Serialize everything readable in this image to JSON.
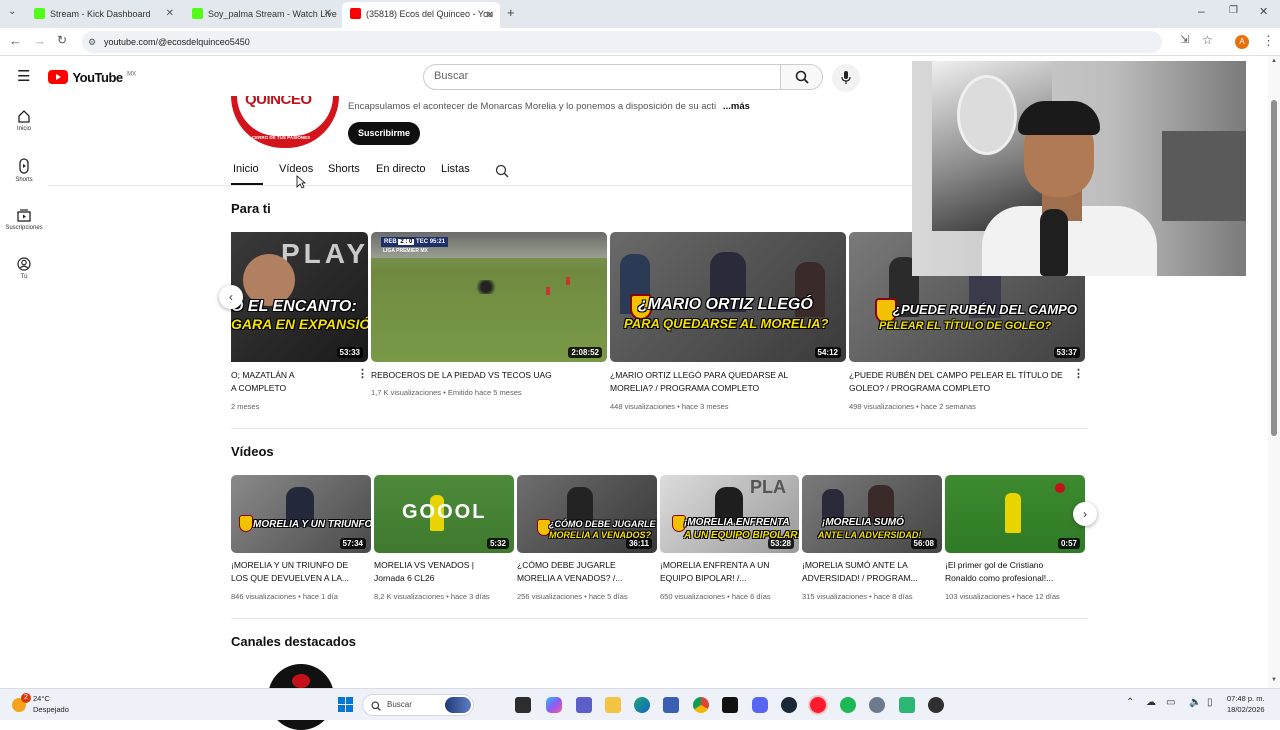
{
  "browser": {
    "tabs": [
      {
        "label": "Stream - Kick Dashboard",
        "active": false
      },
      {
        "label": "Soy_palma Stream - Watch Live",
        "active": false
      },
      {
        "label": "(35818) Ecos del Quinceo - You",
        "active": true
      }
    ],
    "new_tab_label": "+",
    "url": "youtube.com/@ecosdelquinceo5450"
  },
  "yt": {
    "logo_text": "YouTube",
    "region": "MX",
    "search_placeholder": "Buscar"
  },
  "sidebar": {
    "items": [
      {
        "label": "Inicio",
        "icon": "home-icon"
      },
      {
        "label": "Shorts",
        "icon": "shorts-icon"
      },
      {
        "label": "Suscripciones",
        "icon": "subscriptions-icon"
      },
      {
        "label": "Tú",
        "icon": "you-icon"
      }
    ]
  },
  "channel": {
    "avatar_text_1": "QUINCEO",
    "avatar_text_2": "EL CERRO DE TUS PASIONES",
    "description": "Encapsulamos el acontecer de Monarcas Morelia y lo ponemos a disposición de su acti",
    "more_label": "...más",
    "subscribe_label": "Suscribirme",
    "tabs": [
      "Inicio",
      "Vídeos",
      "Shorts",
      "En directo",
      "Listas"
    ]
  },
  "para_ti": {
    "title": "Para ti",
    "videos": [
      {
        "title_1": "O; MAZATLÁN A",
        "title_2": "A COMPLETO",
        "meta": "2 meses",
        "duration": "53:33",
        "caption_1": "O EL ENCANTO:",
        "caption_2": "GARA EN EXPANSIÓN!"
      },
      {
        "title_1": "REBOCEROS DE LA PIEDAD VS TECOS UAG",
        "title_2": "",
        "meta": "1,7 K visualizaciones • Emitido hace 5 meses",
        "duration": "2:08:52",
        "score_home": "REB",
        "score": "2 : 0",
        "score_away": "TEC",
        "score_time": "95:21",
        "league": "LIGA PREMIER MX"
      },
      {
        "title_1": "¿MARIO ORTIZ LLEGÓ PARA QUEDARSE AL",
        "title_2": "MORELIA? / PROGRAMA COMPLETO",
        "meta": "448 visualizaciones • hace 3 meses",
        "duration": "54:12",
        "caption_1": "¿MARIO ORTIZ LLEGÓ",
        "caption_2": "PARA QUEDARSE AL MORELIA?"
      },
      {
        "title_1": "¿PUEDE RUBÉN DEL CAMPO PELEAR EL TÍTULO DE",
        "title_2": "GOLEO? / PROGRAMA COMPLETO",
        "meta": "498 visualizaciones • hace 2 semanas",
        "duration": "53:37",
        "caption_1": "¿PUEDE RUBÉN DEL CAMPO",
        "caption_2": "PELEAR EL TÍTULO DE GOLEO?"
      }
    ]
  },
  "videos_section": {
    "title": "Vídeos",
    "videos": [
      {
        "title_1": "¡MORELIA Y UN TRIUNFO DE",
        "title_2": "LOS QUE DEVUELVEN A LA...",
        "meta": "846 visualizaciones • hace 1 día",
        "duration": "57:34",
        "caption_1": "MORELIA Y UN TRIUNFO",
        "caption_2": ""
      },
      {
        "title_1": "MORELIA VS VENADOS |",
        "title_2": "Jornada 6 CL26",
        "meta": "8,2 K visualizaciones • hace 3 días",
        "duration": "5:32",
        "caption_1": "GOOOL",
        "caption_2": ""
      },
      {
        "title_1": "¿CÓMO DEBE JUGARLE",
        "title_2": "MORELIA A VENADOS? /...",
        "meta": "256 visualizaciones • hace 5 días",
        "duration": "36:11",
        "caption_1": "¿CÓMO DEBE JUGARLE",
        "caption_2": "MORELIA A VENADOS?"
      },
      {
        "title_1": "¡MORELIA ENFRENTA A UN",
        "title_2": "EQUIPO BIPOLAR! /...",
        "meta": "650 visualizaciones • hace 6 días",
        "duration": "53:28",
        "caption_1": "¡MORELIA ENFRENTA",
        "caption_2": "A UN EQUIPO BIPOLAR!"
      },
      {
        "title_1": "¡MORELIA SUMÓ ANTE LA",
        "title_2": "ADVERSIDAD! / PROGRAM...",
        "meta": "315 visualizaciones • hace 8 días",
        "duration": "56:08",
        "caption_1": "¡MORELIA SUMÓ",
        "caption_2": "ANTE LA ADVERSIDAD!"
      },
      {
        "title_1": "¡El primer gol de Cristiano",
        "title_2": "Ronaldo como profesional!...",
        "meta": "103 visualizaciones • hace 12 días",
        "duration": "0:57",
        "caption_1": "",
        "caption_2": ""
      }
    ]
  },
  "featured": {
    "title": "Canales destacados"
  },
  "taskbar": {
    "weather_temp": "24°C",
    "weather_desc": "Despejado",
    "notif_count": "2",
    "search_label": "Buscar",
    "time": "07:48 p. m.",
    "date": "18/02/2026"
  },
  "colors": {
    "yt_red": "#ff0000",
    "caption_yellow": "#f5e100",
    "avatar_red": "#d4141c"
  }
}
